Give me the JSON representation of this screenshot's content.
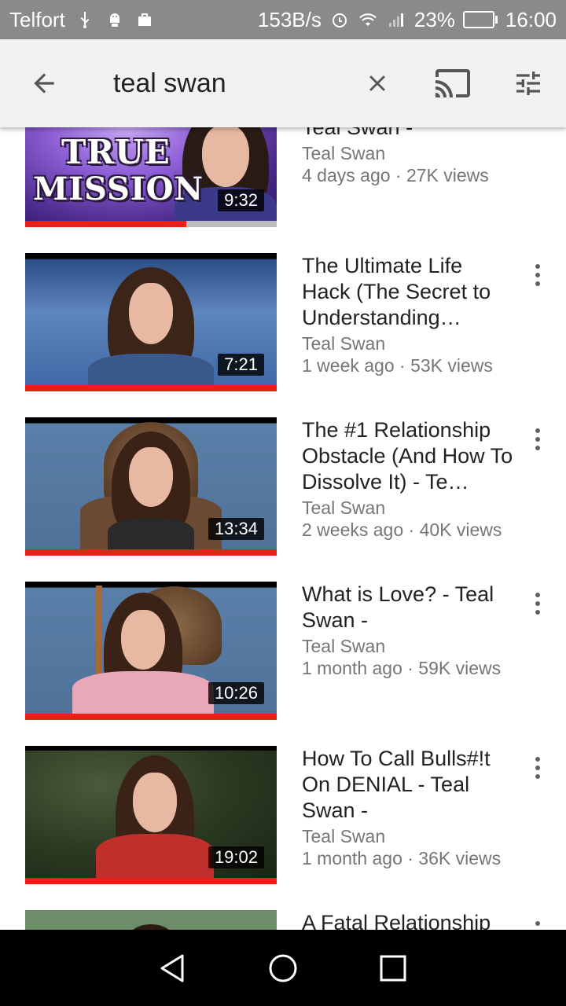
{
  "status_bar": {
    "carrier": "Telfort",
    "net_speed": "153B/s",
    "battery": "23%",
    "battery_level": 0.23,
    "time": "16:00"
  },
  "search_bar": {
    "query": "teal swan"
  },
  "videos": [
    {
      "title": "True Mission of God - Teal Swan -",
      "channel": "Teal Swan",
      "meta": "4 days ago · 27K views",
      "duration": "9:32",
      "progress": 0.64,
      "thumb_text": [
        "TRUE",
        "MISSION"
      ]
    },
    {
      "title": "The Ultimate Life Hack (The Secret to Understanding…",
      "channel": "Teal Swan",
      "meta": "1 week ago · 53K views",
      "duration": "7:21",
      "progress": 1.0
    },
    {
      "title": "The #1 Relationship Obstacle (And How To Dissolve It) - Te…",
      "channel": "Teal Swan",
      "meta": "2 weeks ago · 40K views",
      "duration": "13:34",
      "progress": 1.0
    },
    {
      "title": "What is Love? - Teal Swan -",
      "channel": "Teal Swan",
      "meta": "1 month ago · 59K views",
      "duration": "10:26",
      "progress": 1.0
    },
    {
      "title": "How To Call Bulls#!t On DENIAL - Teal Swan -",
      "channel": "Teal Swan",
      "meta": "1 month ago · 36K views",
      "duration": "19:02",
      "progress": 1.0
    },
    {
      "title": "A Fatal Relationship",
      "channel": "",
      "meta": "",
      "duration": "",
      "progress": 0
    }
  ],
  "colors": {
    "accent": "#e62117",
    "status_bar": "#8a8a8a",
    "app_bar": "#f2f2f2"
  }
}
